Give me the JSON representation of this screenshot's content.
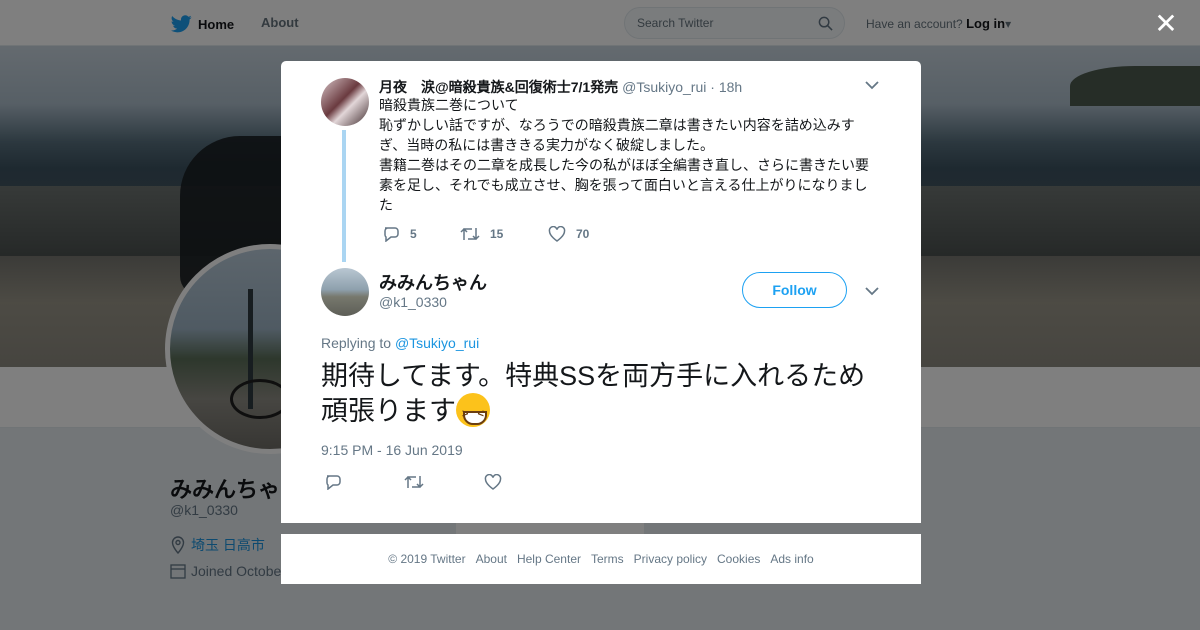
{
  "topnav": {
    "home_label": "Home",
    "about_label": "About",
    "search_placeholder": "Search Twitter",
    "account_prompt": "Have an account?",
    "login_label": "Log in"
  },
  "profile": {
    "name": "みみんちゃ",
    "handle": "@k1_0330",
    "location": "埼玉 日高市",
    "joined": "Joined Octobe"
  },
  "parent_tweet": {
    "name": "月夜　涙@暗殺貴族&回復術士7/1発売",
    "handle": "@Tsukiyo_rui",
    "time": "· 18h",
    "text": "暗殺貴族二巻について\n恥ずかしい話ですが、なろうでの暗殺貴族二章は書きたい内容を詰め込みすぎ、当時の私には書ききる実力がなく破綻しました。\n書籍二巻はその二章を成長した今の私がほぼ全編書き直し、さらに書きたい要素を足し、それでも成立させ、胸を張って面白いと言える仕上がりになりました",
    "replies": "5",
    "retweets": "15",
    "likes": "70"
  },
  "main_tweet": {
    "name": "みみんちゃん",
    "handle": "@k1_0330",
    "follow_label": "Follow",
    "replying_prefix": "Replying to",
    "replying_to": "@Tsukiyo_rui",
    "text": "期待してます。特典SSを両方手に入れるため頑張ります",
    "emoji": "grinning-squinting-face",
    "timestamp": "9:15 PM - 16 Jun 2019"
  },
  "footer": {
    "copyright": "© 2019 Twitter",
    "about": "About",
    "help": "Help Center",
    "terms": "Terms",
    "privacy": "Privacy policy",
    "cookies": "Cookies",
    "ads": "Ads info"
  },
  "colors": {
    "accent": "#1da1f2",
    "link": "#1b95e0",
    "muted": "#657786"
  },
  "icons": [
    "twitter-bird-icon",
    "search-icon",
    "close-icon",
    "reply-icon",
    "retweet-icon",
    "like-icon",
    "chevron-down-icon",
    "location-pin-icon",
    "calendar-icon"
  ]
}
